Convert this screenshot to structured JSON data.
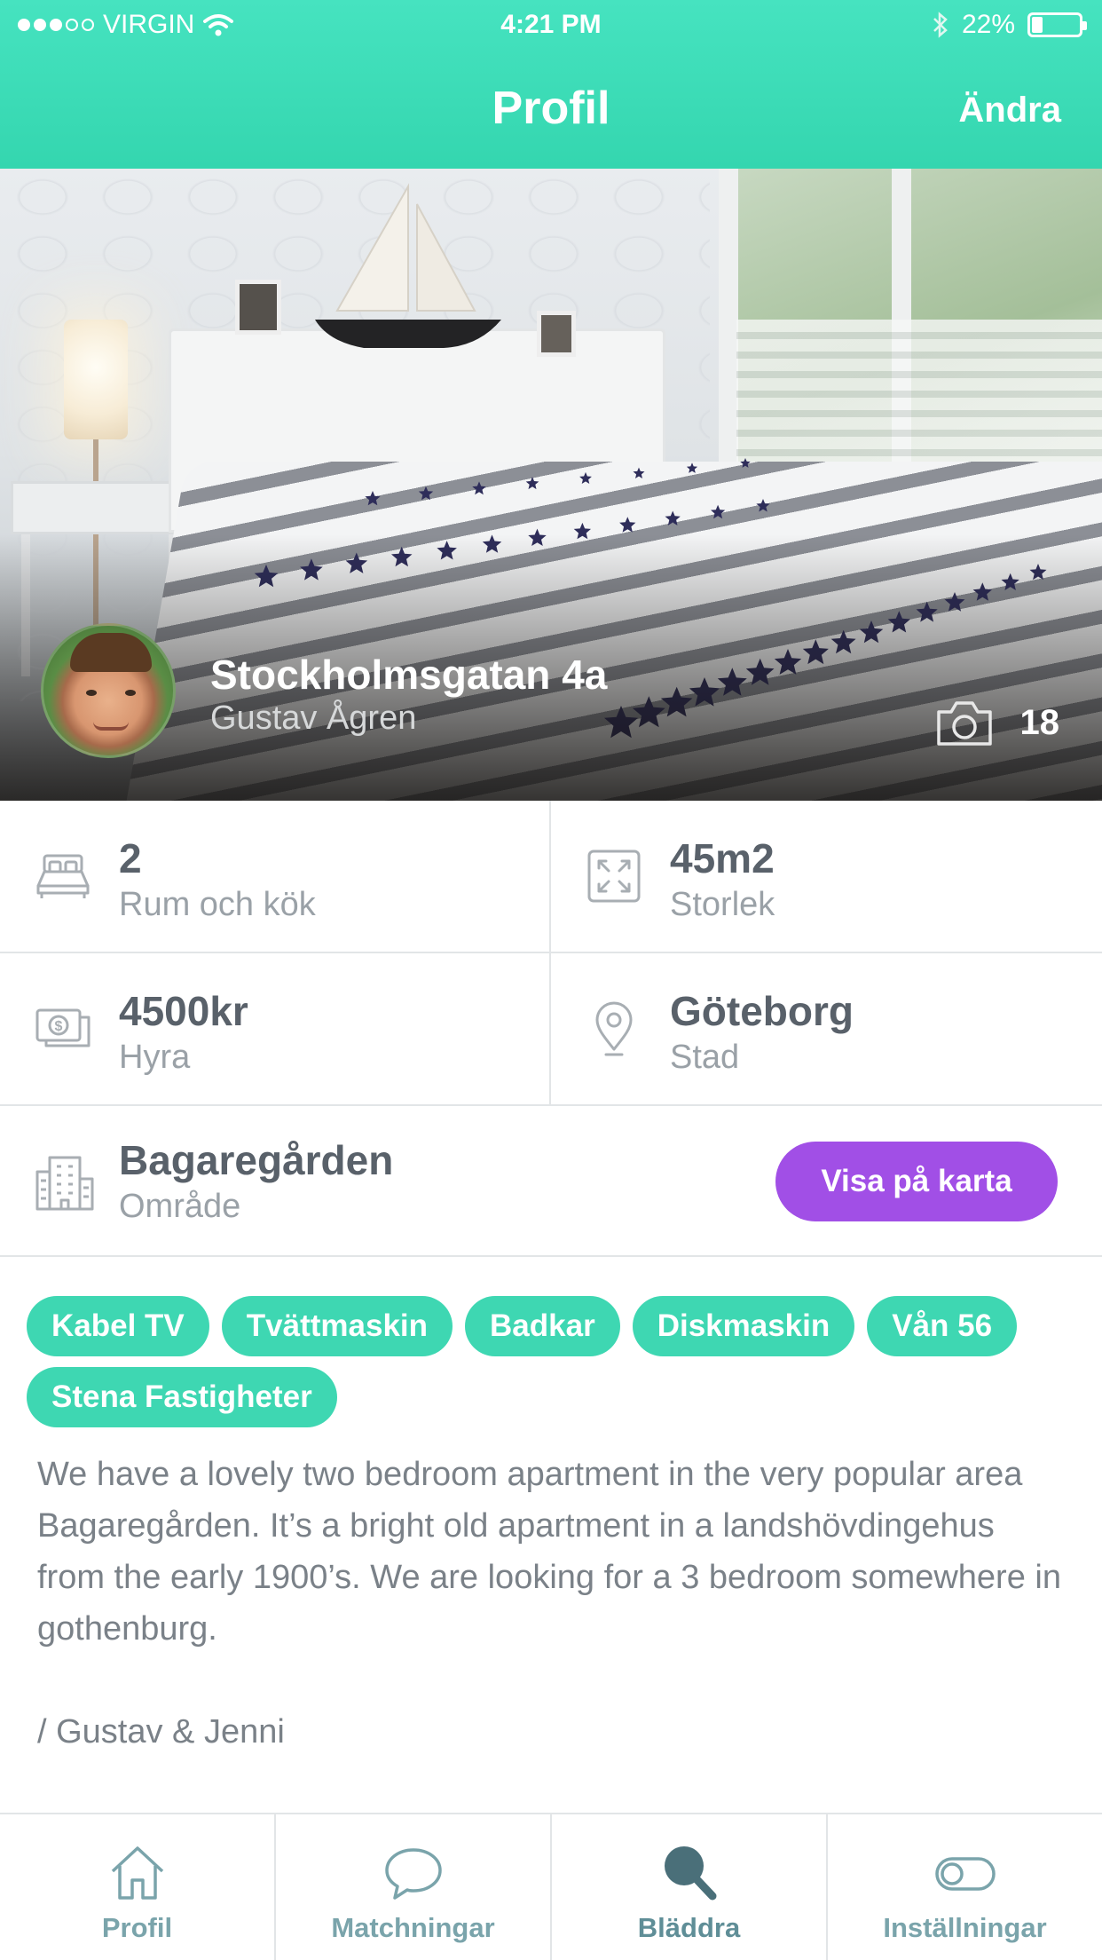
{
  "status_bar": {
    "carrier": "VIRGIN",
    "time": "4:21 PM",
    "battery": "22%",
    "battery_level": 0.22
  },
  "nav": {
    "title": "Profil",
    "edit": "Ändra"
  },
  "hero": {
    "title": "Stockholmsgatan 4a",
    "owner": "Gustav Ågren",
    "photo_count": "18"
  },
  "details": {
    "rooms": {
      "value": "2",
      "label": "Rum och kök",
      "icon": "bed-icon"
    },
    "size": {
      "value": "45m2",
      "label": "Storlek",
      "icon": "expand-icon"
    },
    "rent": {
      "value": "4500kr",
      "label": "Hyra",
      "icon": "money-icon"
    },
    "city": {
      "value": "Göteborg",
      "label": "Stad",
      "icon": "location-pin-icon"
    },
    "area": {
      "value": "Bagaregården",
      "label": "Område",
      "icon": "building-icon"
    },
    "map_button": "Visa på karta"
  },
  "tags": [
    "Kabel TV",
    "Tvättmaskin",
    "Badkar",
    "Diskmaskin",
    "Vån 56",
    "Stena Fastigheter"
  ],
  "description": "We have a lovely two bedroom apartment in the very popular area Bagaregården. It’s a bright old apartment in a landshövdingehus from the early 1900’s. We are looking for a 3 bedroom somewhere in gothenburg.\n\n/ Gustav & Jenni",
  "tabbar": {
    "tabs": [
      {
        "label": "Profil",
        "icon": "home-icon"
      },
      {
        "label": "Matchningar",
        "icon": "chat-bubble-icon"
      },
      {
        "label": "Bläddra",
        "icon": "search-icon"
      },
      {
        "label": "Inställningar",
        "icon": "toggle-icon"
      }
    ]
  },
  "colors": {
    "brand": "#3ed7b2",
    "button": "#a14fe6",
    "text": "#59616a",
    "muted": "#9aa1a7",
    "tab_icon": "#7aa4ab",
    "tab_active_icon": "#4a6f79"
  }
}
